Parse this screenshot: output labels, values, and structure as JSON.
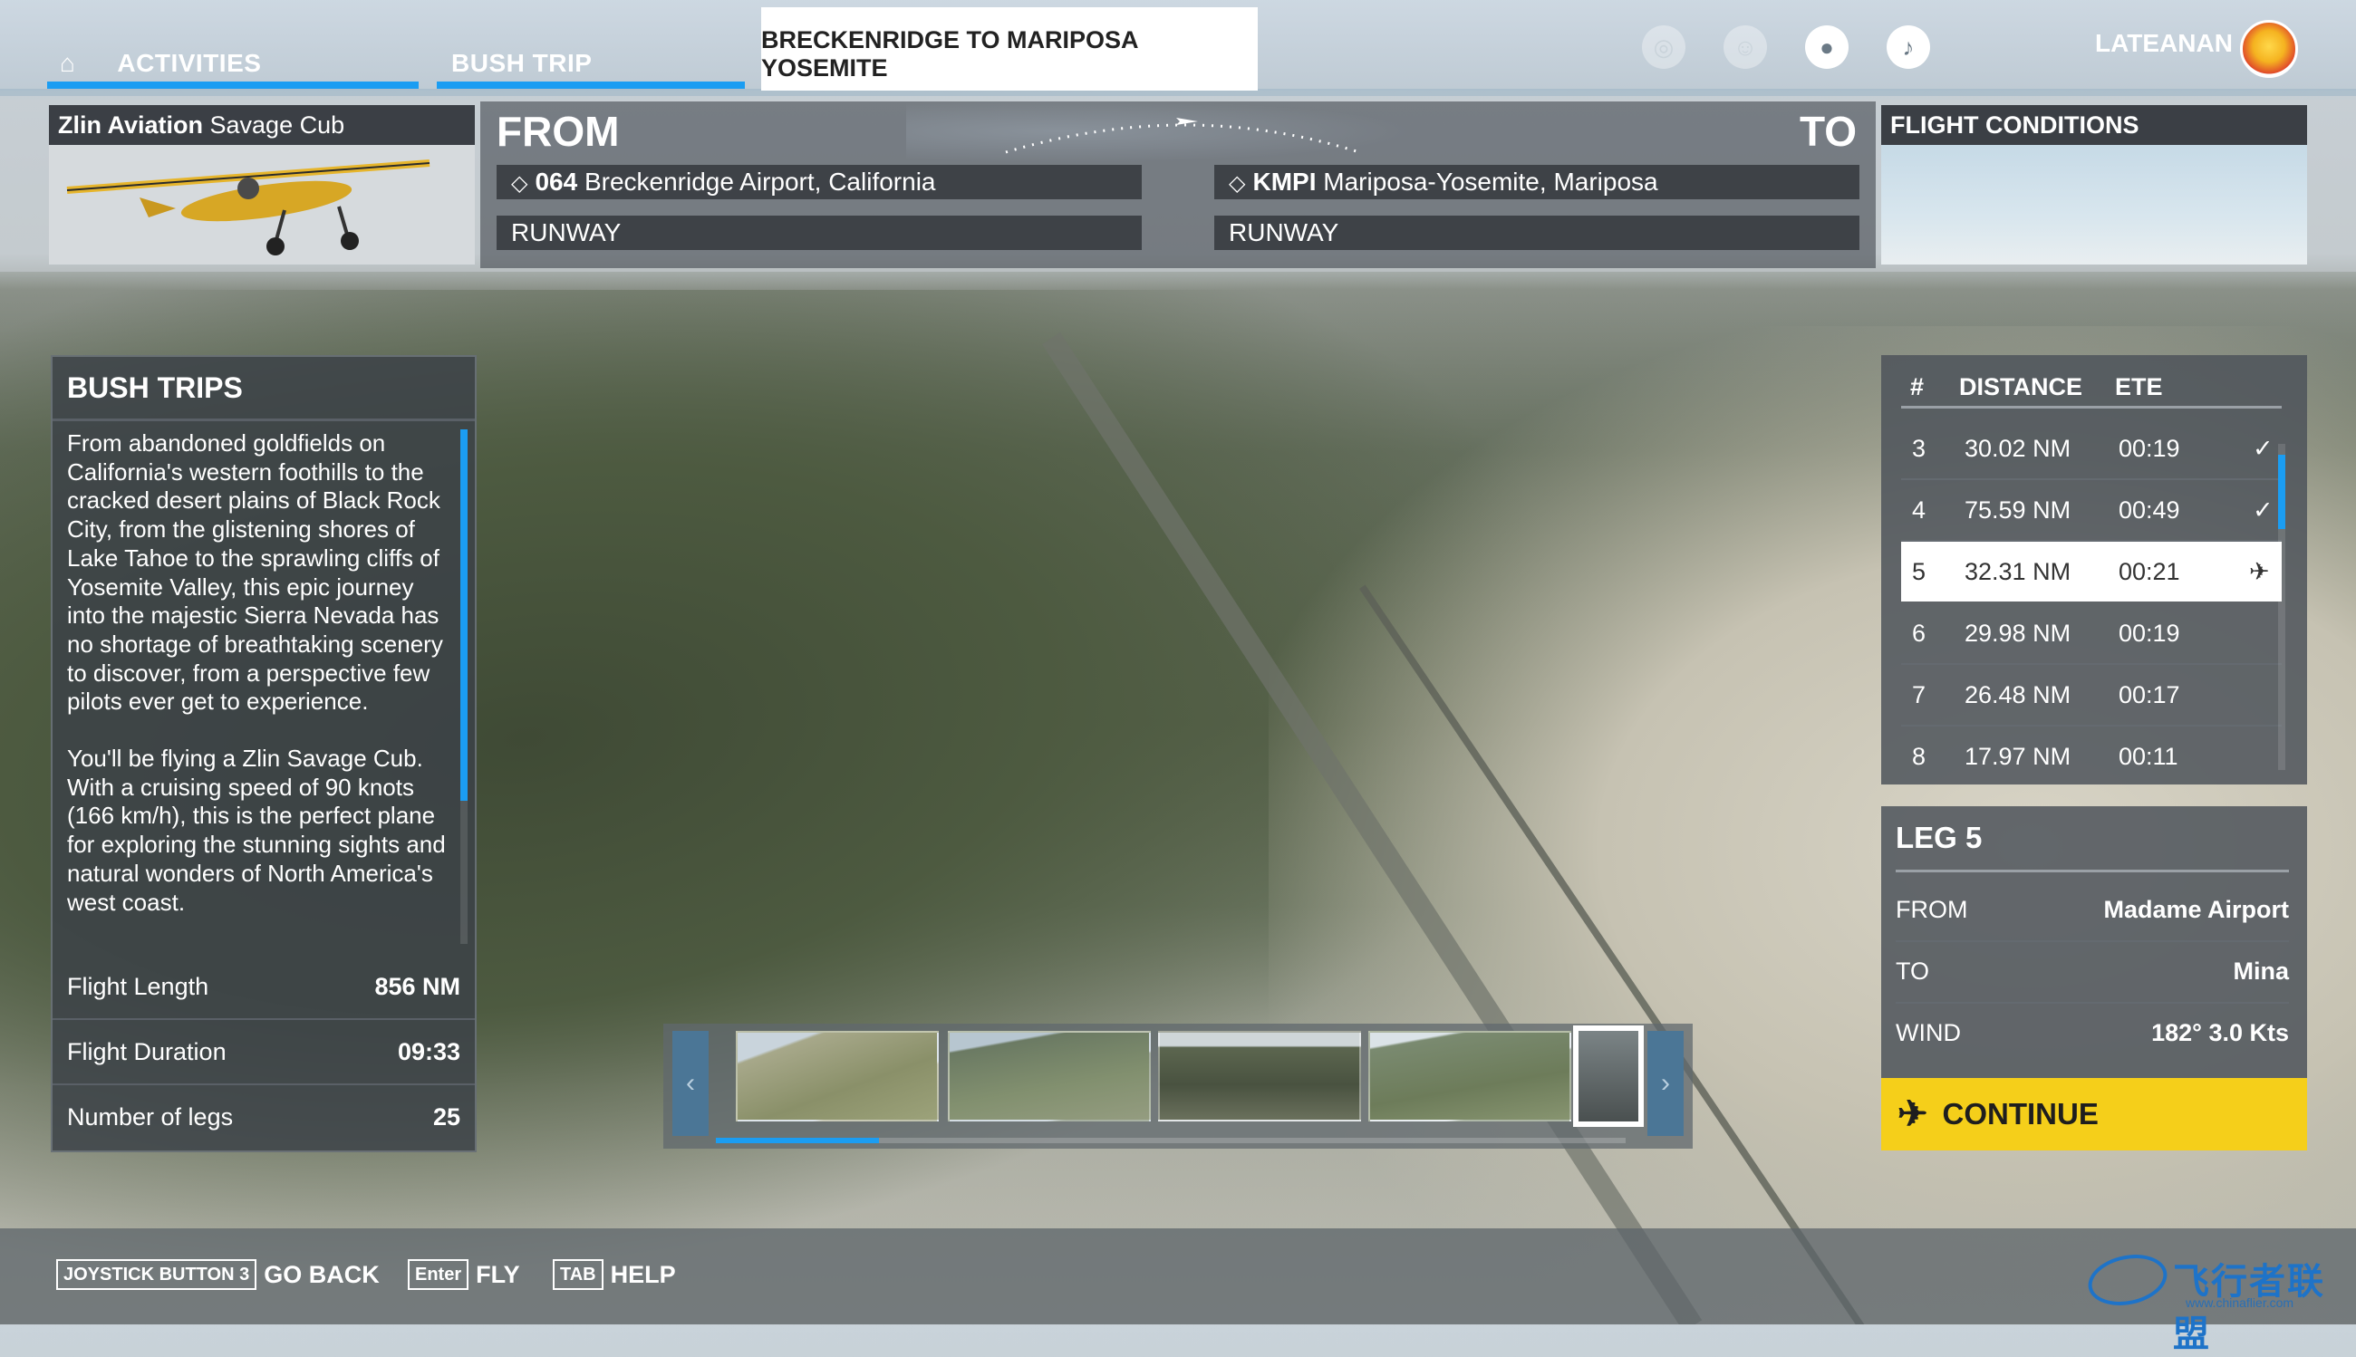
{
  "topnav": {
    "home_icon": "home-icon",
    "activities_label": "ACTIVITIES",
    "bushtrip_label": "BUSH TRIP",
    "active_tab_label": "BRECKENRIDGE TO MARIPOSA YOSEMITE",
    "icons": [
      "achievements-icon",
      "friends-icon",
      "profile-icon",
      "notifications-icon"
    ],
    "username": "LATEANAN",
    "accent_color": "#1b9df2"
  },
  "aircraft": {
    "brand": "Zlin Aviation",
    "model": "Savage Cub"
  },
  "route": {
    "from_label": "FROM",
    "to_label": "TO",
    "from_code": "064",
    "from_name": "Breckenridge Airport, California",
    "to_code": "KMPI",
    "to_name": "Mariposa-Yosemite, Mariposa",
    "from_runway": "RUNWAY",
    "to_runway": "RUNWAY"
  },
  "flight_conditions": {
    "title": "FLIGHT CONDITIONS"
  },
  "bush_trips": {
    "title": "BUSH TRIPS",
    "paragraphs": [
      "From abandoned goldfields on California's western foothills to the cracked desert plains of Black Rock City, from the glistening shores of Lake Tahoe to the sprawling cliffs of Yosemite Valley, this epic journey into the majestic Sierra Nevada has no shortage of breathtaking scenery to discover, from a perspective few pilots ever get to experience.",
      "You'll be flying a Zlin Savage Cub. With a cruising speed of 90 knots (166 km/h), this is the perfect plane for exploring the stunning sights and natural wonders of North America's west coast."
    ],
    "stats": [
      {
        "label": "Flight Length",
        "value": "856 NM"
      },
      {
        "label": "Flight Duration",
        "value": "09:33"
      },
      {
        "label": "Number of legs",
        "value": "25"
      }
    ]
  },
  "legs_table": {
    "headers": [
      "#",
      "DISTANCE",
      "ETE"
    ],
    "rows": [
      {
        "num": "3",
        "distance": "30.02 NM",
        "ete": "00:19",
        "status": "✓"
      },
      {
        "num": "4",
        "distance": "75.59 NM",
        "ete": "00:49",
        "status": "✓"
      },
      {
        "num": "5",
        "distance": "32.31 NM",
        "ete": "00:21",
        "status": "✈"
      },
      {
        "num": "6",
        "distance": "29.98 NM",
        "ete": "00:19",
        "status": ""
      },
      {
        "num": "7",
        "distance": "26.48 NM",
        "ete": "00:17",
        "status": ""
      },
      {
        "num": "8",
        "distance": "17.97 NM",
        "ete": "00:11",
        "status": ""
      }
    ]
  },
  "leg_detail": {
    "title": "LEG 5",
    "from_label": "FROM",
    "from_value": "Madame Airport",
    "to_label": "TO",
    "to_value": "Mina",
    "wind_label": "WIND",
    "wind_value": "182° 3.0 Kts"
  },
  "continue_label": "CONTINUE",
  "gallery": {
    "prev": "‹",
    "next": "›"
  },
  "bottom_hints": [
    {
      "key": "JOYSTICK BUTTON 3",
      "action": "GO BACK"
    },
    {
      "key": "Enter",
      "action": "FLY"
    },
    {
      "key": "TAB",
      "action": "HELP"
    }
  ],
  "watermark": {
    "text": "飞行者联盟",
    "url": "www.chinaflier.com"
  }
}
